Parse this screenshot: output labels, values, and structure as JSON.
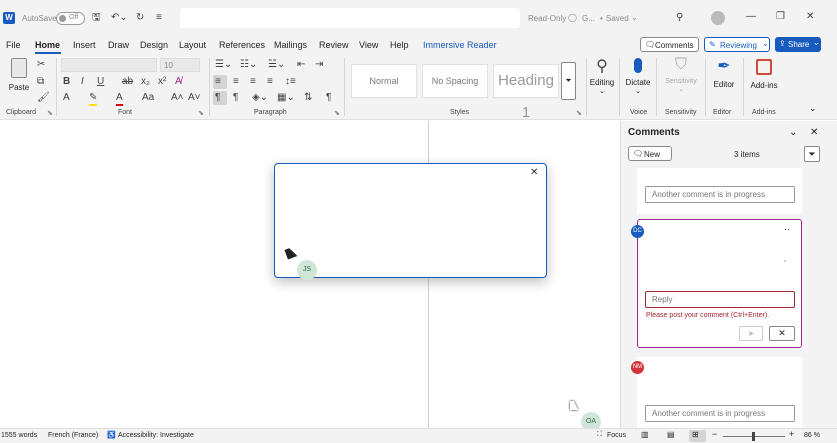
{
  "titlebar": {
    "app_icon": "W",
    "autosave_label": "AutoSave",
    "autosave_state": "Off",
    "doc_status": "Read-Only",
    "sensitivity": "G...",
    "saved": "Saved"
  },
  "menu": {
    "items": [
      "File",
      "Home",
      "Insert",
      "Draw",
      "Design",
      "Layout",
      "References",
      "Mailings",
      "Review",
      "View",
      "Help",
      "Immersive Reader"
    ],
    "active": "Home",
    "comments_btn": "Comments",
    "reviewing_btn": "Reviewing",
    "share_btn": "Share"
  },
  "ribbon": {
    "paste": "Paste",
    "font_size": "10",
    "styles": [
      "Normal",
      "No Spacing",
      "Heading 1"
    ],
    "editing": "Editing",
    "dictate": "Dictate",
    "sensitivity": "Sensitivity",
    "editor": "Editor",
    "addins": "Add-ins",
    "groups": {
      "clipboard": "Clipboard",
      "font": "Font",
      "paragraph": "Paragraph",
      "styles": "Styles",
      "voice": "Voice",
      "sensitivity": "Sensitivity",
      "editor": "Editor",
      "addins": "Add-ins"
    }
  },
  "popup": {
    "avatar": "JS",
    "close": "✕"
  },
  "comments": {
    "title": "Comments",
    "new_btn": "New",
    "count": "3 items",
    "c1_input": "Another comment is in progress",
    "c2_avatar": "DC",
    "c2_more": "··",
    "reply_placeholder": "Reply",
    "error": "Please post your comment (Ctrl+Enter).",
    "c3_avatar": "NM",
    "c3_input": "Another comment is in progress"
  },
  "doc": {
    "avatar": "OA"
  },
  "status": {
    "words": "1555 words",
    "language": "French (France)",
    "accessibility": "Accessibility: Investigate",
    "focus": "Focus",
    "zoom": "86 %"
  }
}
